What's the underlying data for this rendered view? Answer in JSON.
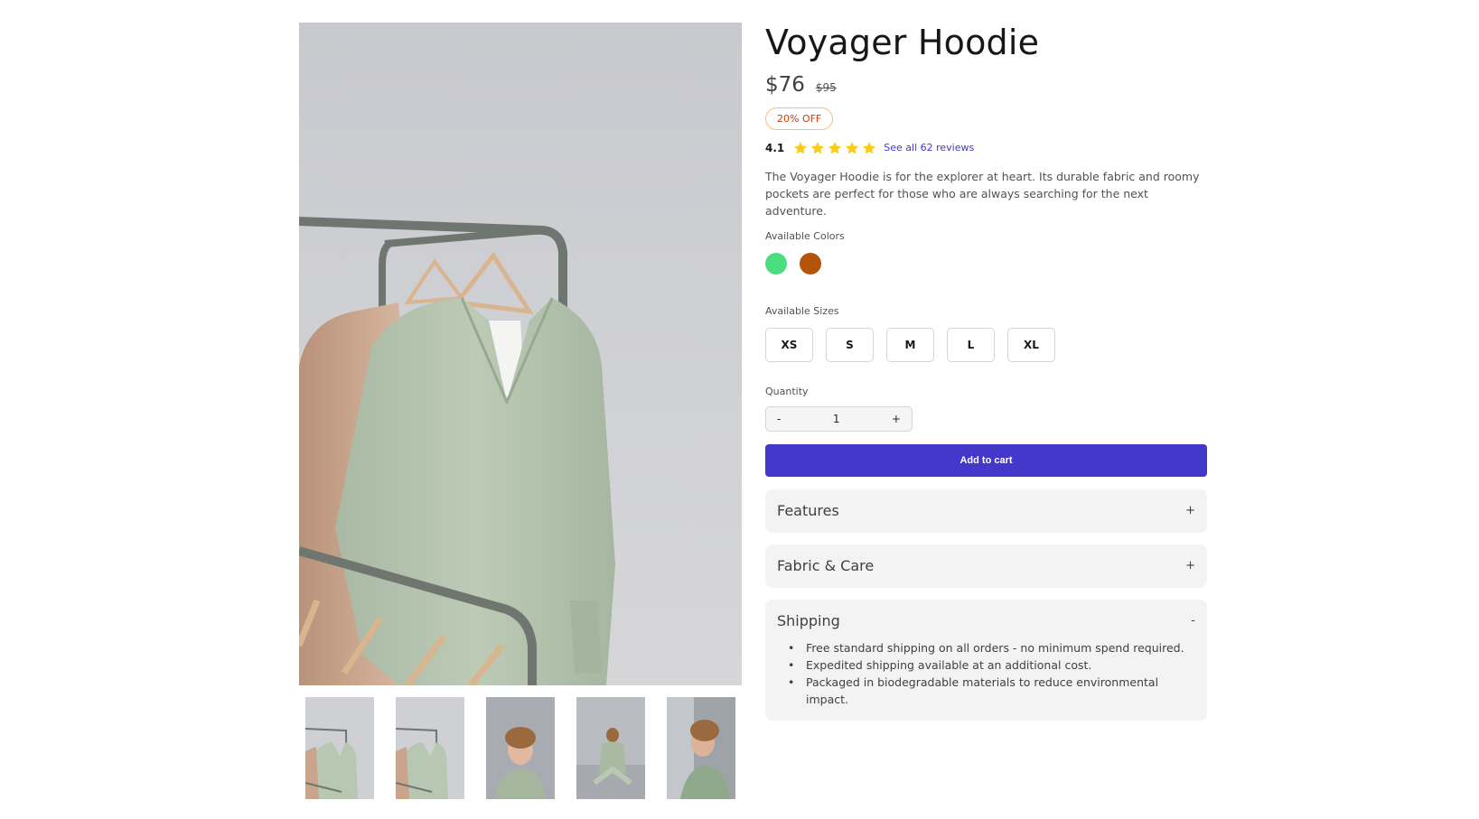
{
  "product": {
    "title": "Voyager Hoodie",
    "price": "$76",
    "original_price": "$95",
    "discount_badge": "20% OFF",
    "rating": "4.1",
    "rating_value": 4.1,
    "stars_shown": 5,
    "reviews_link": "See all 62 reviews",
    "description": "The Voyager Hoodie is for the explorer at heart. Its durable fabric and roomy pockets are perfect for those who are always searching for the next adventure."
  },
  "colors": {
    "label": "Available Colors",
    "options": [
      {
        "name": "green",
        "hex": "#4ade80"
      },
      {
        "name": "rust",
        "hex": "#b45309"
      }
    ]
  },
  "sizes": {
    "label": "Available Sizes",
    "options": [
      "XS",
      "S",
      "M",
      "L",
      "XL"
    ]
  },
  "quantity": {
    "label": "Quantity",
    "decrement": "-",
    "value": "1",
    "increment": "+"
  },
  "add_to_cart": "Add to cart",
  "accordions": [
    {
      "title": "Features",
      "toggle": "+",
      "expanded": false,
      "items": []
    },
    {
      "title": "Fabric & Care",
      "toggle": "+",
      "expanded": false,
      "items": []
    },
    {
      "title": "Shipping",
      "toggle": "-",
      "expanded": true,
      "items": [
        "Free standard shipping on all orders - no minimum spend required.",
        "Expedited shipping available at an additional cost.",
        "Packaged in biodegradable materials to reduce environmental impact."
      ]
    }
  ],
  "gallery": {
    "thumbnails": [
      "hoodie-on-rack",
      "hoodie-on-rack",
      "model-portrait",
      "model-sitting",
      "model-profile"
    ]
  },
  "theme": {
    "accent": "#4338ca",
    "star": "#facc15",
    "badge_text": "#c2410c",
    "hoodie_green": "#b9c9b3"
  }
}
